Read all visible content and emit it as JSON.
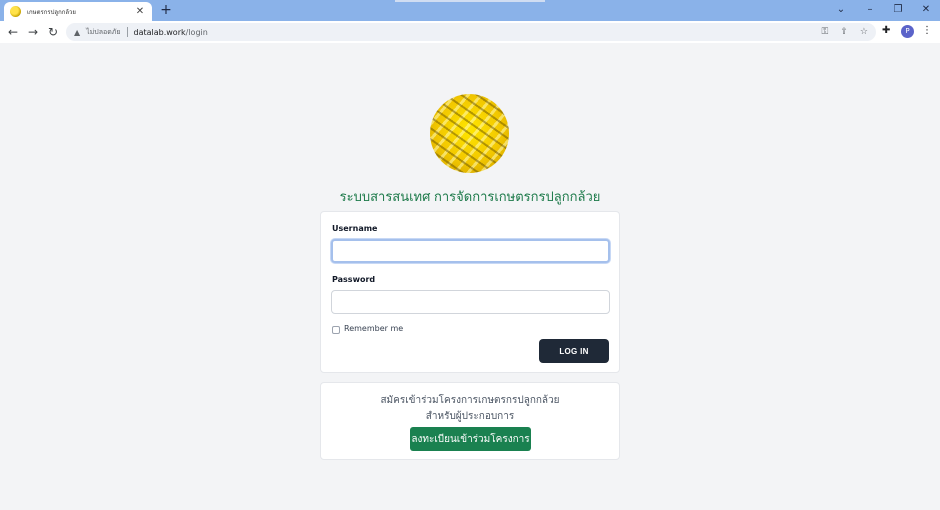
{
  "browser": {
    "tab_title": "เกษตรกรปลูกกล้วย",
    "tab_close": "✕",
    "new_tab": "+",
    "window_controls": {
      "dropdown": "⌄",
      "minimize": "–",
      "restore": "❐",
      "close": "✕"
    },
    "nav": {
      "back": "←",
      "forward": "→",
      "reload": "↻"
    },
    "security_label": "ไม่ปลอดภัย",
    "warning_icon": "▲",
    "url_host": "datalab.work",
    "url_path": "/login",
    "omnibox_icons": {
      "key": "⚿",
      "share": "⇪",
      "star": "☆"
    },
    "extensions_icon": "✚",
    "profile_initial": "P",
    "menu_icon": "⋮"
  },
  "page": {
    "system_title": "ระบบสารสนเทศ การจัดการเกษตรกรปลูกกล้วย",
    "login": {
      "username_label": "Username",
      "username_value": "",
      "password_label": "Password",
      "password_value": "",
      "remember_label": "Remember me",
      "login_button": "LOG IN"
    },
    "register": {
      "line1": "สมัครเข้าร่วมโครงการเกษตรกรปลูกกล้วย",
      "line2": "สำหรับผู้ประกอบการ",
      "button": "ลงทะเบียนเข้าร่วมโครงการ"
    }
  },
  "colors": {
    "tabstrip": "#8ab2e9",
    "title_green": "#1d7a4a",
    "login_button": "#1f2937",
    "register_button": "#1a8150",
    "page_background": "#f3f4f6"
  }
}
